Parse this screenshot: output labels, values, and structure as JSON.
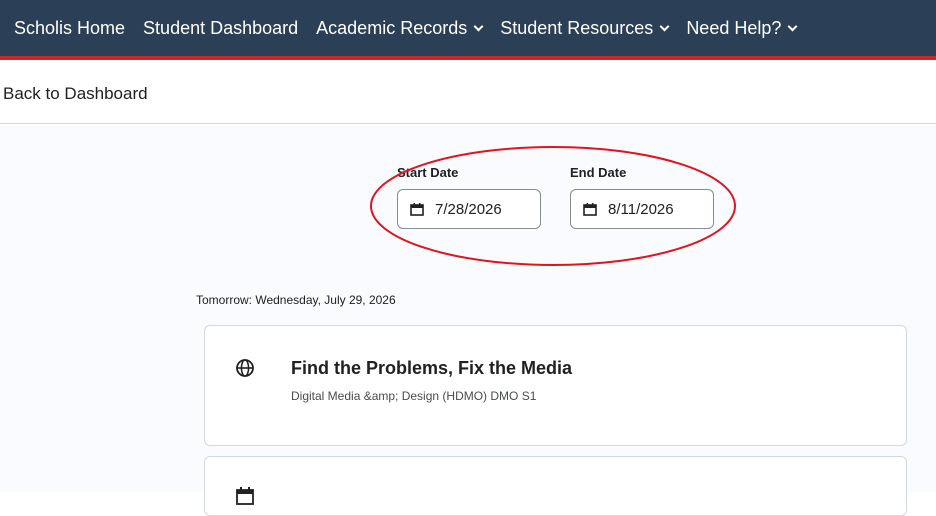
{
  "nav": {
    "items": [
      {
        "label": "Scholis Home",
        "dropdown": false
      },
      {
        "label": "Student Dashboard",
        "dropdown": false
      },
      {
        "label": "Academic Records",
        "dropdown": true
      },
      {
        "label": "Student Resources",
        "dropdown": true
      },
      {
        "label": "Need Help?",
        "dropdown": true
      }
    ]
  },
  "back_link": "Back to Dashboard",
  "filters": {
    "start": {
      "label": "Start Date",
      "value": "7/28/2026"
    },
    "end": {
      "label": "End Date",
      "value": "8/11/2026"
    }
  },
  "day_heading": "Tomorrow: Wednesday, July 29, 2026",
  "items": [
    {
      "title": "Find the Problems, Fix the Media",
      "subtitle": "Digital Media &amp; Design (HDMO) DMO S1",
      "icon": "globe-icon"
    },
    {
      "title": "",
      "subtitle": "",
      "icon": "calendar-icon"
    }
  ],
  "colors": {
    "nav_bg": "#2b3f56",
    "nav_accent": "#c6282d",
    "highlight": "#e0141e",
    "content_bg": "#f9fbff"
  }
}
